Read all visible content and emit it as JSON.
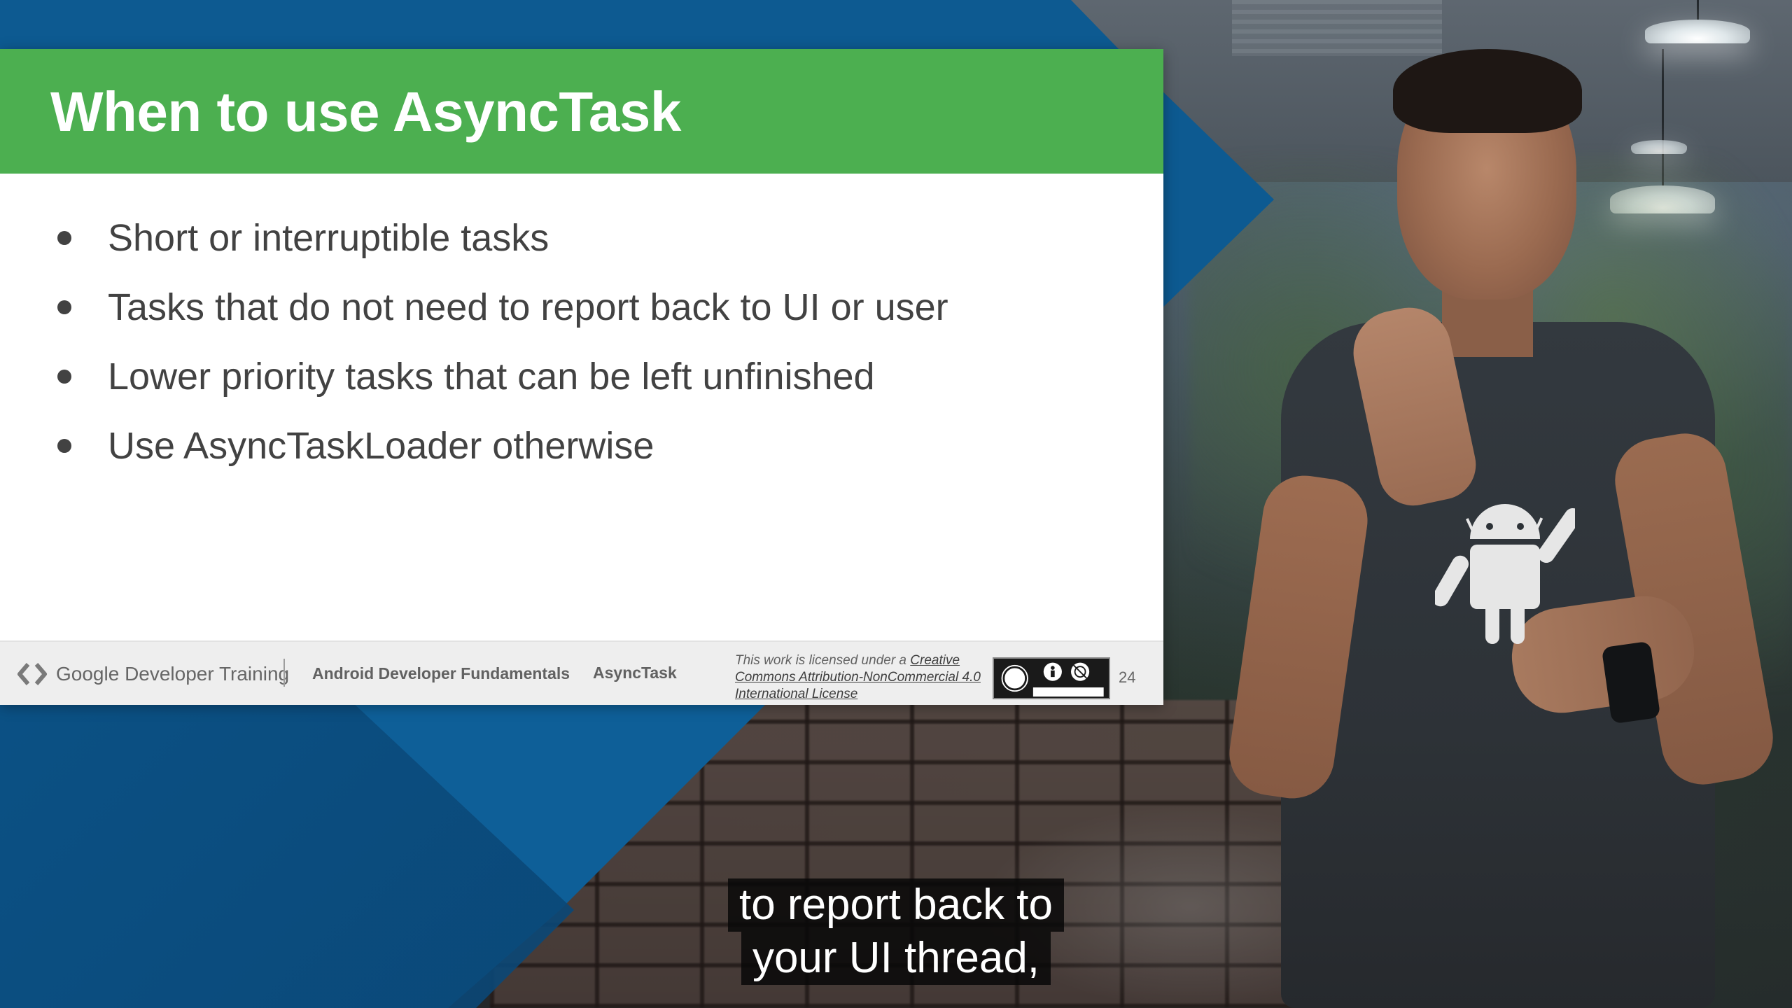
{
  "slide": {
    "title": "When to use AsyncTask",
    "bullets": [
      "Short or interruptible tasks",
      "Tasks that do not need to report back to UI or user",
      "Lower priority tasks that can be left unfinished",
      "Use AsyncTaskLoader otherwise"
    ],
    "footer": {
      "brand": "Google Developer Training",
      "course": "Android Developer Fundamentals",
      "topic": "AsyncTask",
      "license_prefix": "This work is licensed under a ",
      "license_link": "Creative Commons Attribution-NonCommercial 4.0 International License",
      "page_number": "24"
    }
  },
  "captions": {
    "line1": "to report back to",
    "line2": "your UI thread,"
  },
  "colors": {
    "header_green": "#4caf50",
    "accent_blue": "#0d5a91",
    "text_gray": "#424242"
  },
  "icons": {
    "logo": "google-developers-chevrons-icon",
    "license": "creative-commons-by-nc-badge-icon",
    "shirt": "android-robot-icon"
  }
}
